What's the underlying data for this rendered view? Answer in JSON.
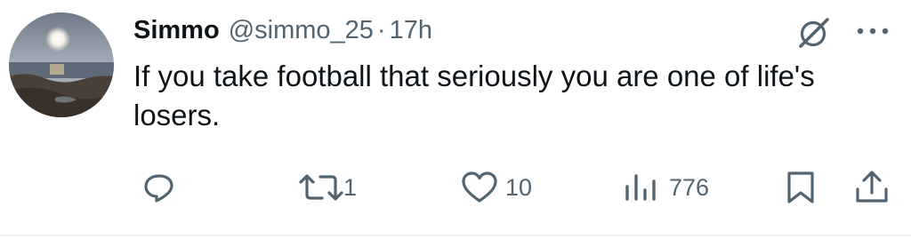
{
  "tweet": {
    "author_name": "Simmo",
    "handle": "@simmo_25",
    "separator": "·",
    "time": "17h",
    "text": "If you take football that seriously you are one of life's losers.",
    "stats": {
      "replies": "",
      "retweets": "1",
      "likes": "10",
      "views": "776"
    }
  },
  "icons": {
    "reply": "reply-icon",
    "retweet": "retweet-icon",
    "like": "heart-icon",
    "views": "analytics-icon",
    "bookmark": "bookmark-icon",
    "share": "share-icon",
    "grok": "grok-icon",
    "more": "more-icon"
  },
  "colors": {
    "text": "#0f1419",
    "secondary": "#536471",
    "divider": "#eff3f4"
  }
}
